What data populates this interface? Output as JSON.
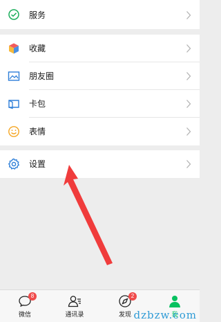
{
  "menu": {
    "services": {
      "label": "服务",
      "icon": "services-check-icon"
    },
    "favorites": {
      "label": "收藏",
      "icon": "favorites-cube-icon"
    },
    "moments": {
      "label": "朋友圈",
      "icon": "moments-photo-icon"
    },
    "cards": {
      "label": "卡包",
      "icon": "card-wallet-icon"
    },
    "stickers": {
      "label": "表情",
      "icon": "smiley-icon"
    },
    "settings": {
      "label": "设置",
      "icon": "gear-icon"
    }
  },
  "tabbar": {
    "chats": {
      "label": "微信",
      "badge": "8"
    },
    "contacts": {
      "label": "通讯录"
    },
    "discover": {
      "label": "发现",
      "badge": "2"
    },
    "me": {
      "label": "我"
    }
  },
  "colors": {
    "accent": "#07c160",
    "badge": "#f04b4b",
    "arrow": "#f03c3c"
  },
  "watermark": "dzbzw.com"
}
